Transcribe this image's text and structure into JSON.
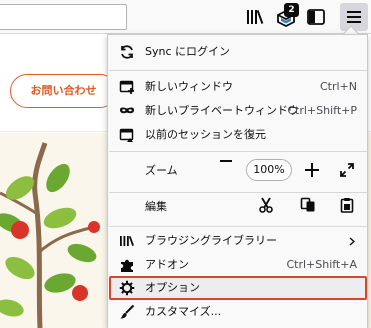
{
  "toolbar": {
    "pocket_badge": "2",
    "icons": [
      "library-icon",
      "pocket-icon",
      "sidebar-icon",
      "hamburger-menu-icon"
    ]
  },
  "page": {
    "contact_button": "お問い合わせ",
    "accent_color": "#e05a26"
  },
  "app_menu": {
    "sync": "Sync にログイン",
    "new_window": {
      "label": "新しいウィンドウ",
      "shortcut": "Ctrl+N"
    },
    "private_window": {
      "label": "新しいプライベートウィンドウ",
      "shortcut": "Ctrl+Shift+P"
    },
    "restore_session": "以前のセッションを復元",
    "zoom": {
      "label": "ズーム",
      "value": "100%"
    },
    "edit": {
      "label": "編集"
    },
    "library": "ブラウジングライブラリー",
    "addons": {
      "label": "アドオン",
      "shortcut": "Ctrl+Shift+A"
    },
    "options": "オプション",
    "customize": "カスタマイズ..."
  },
  "highlight_color": "#d6462c"
}
